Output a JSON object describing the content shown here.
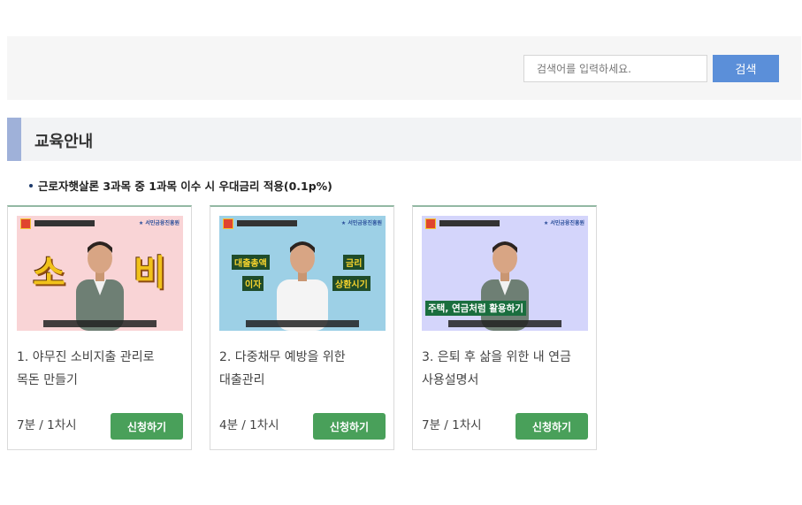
{
  "search": {
    "placeholder": "검색어를 입력하세요.",
    "button_label": "검색"
  },
  "section": {
    "title": "교육안내"
  },
  "notice": "근로자햇살론 3과목 중 1과목 이수 시 우대금리 적용(0.1p%)",
  "colors": {
    "search_button": "#5b8fd9",
    "apply_button": "#49a05a",
    "section_accent": "#9fb1d9",
    "thumb_1_bg": "#f9d4d6",
    "thumb_2_bg": "#9dd0e6",
    "thumb_3_bg": "#d4d5fb"
  },
  "courses": [
    {
      "title_line1": "1. 야무진 소비지출 관리로",
      "title_line2": "목돈 만들기",
      "meta": "7분 / 1차시",
      "apply_label": "신청하기",
      "thumb_words": [
        "소",
        "비"
      ]
    },
    {
      "title_line1": "2. 다중채무 예방을 위한",
      "title_line2": "대출관리",
      "meta": "4분 / 1차시",
      "apply_label": "신청하기",
      "thumb_words": [
        "대출총액",
        "금리",
        "이자",
        "상환시기"
      ]
    },
    {
      "title_line1": "3. 은퇴 후 삶을 위한 내 연금",
      "title_line2": "사용설명서",
      "meta": "7분 / 1차시",
      "apply_label": "신청하기",
      "thumb_words": [
        "주택, 연금처럼 활용하기"
      ]
    }
  ]
}
